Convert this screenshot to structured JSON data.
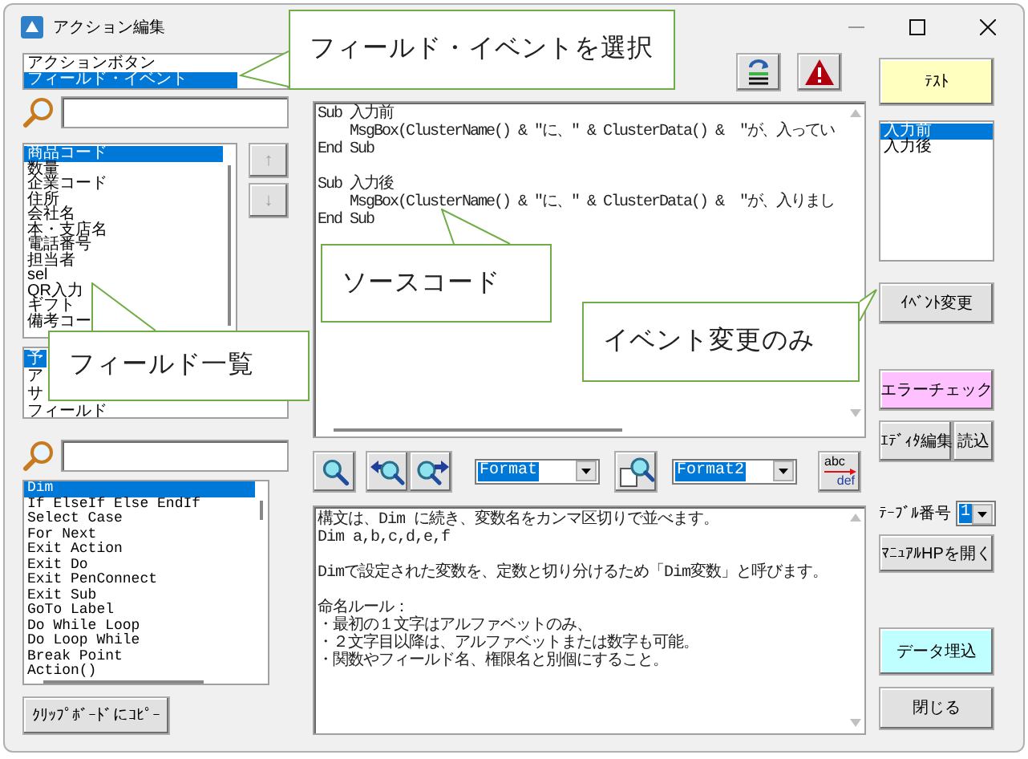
{
  "window": {
    "title": "アクション編集"
  },
  "type_list": {
    "items": [
      {
        "label": "アクションボタン",
        "selected": false
      },
      {
        "label": "フィールド・イベント",
        "selected": true
      }
    ]
  },
  "field_list": {
    "items": [
      {
        "label": "商品コード",
        "selected": true
      },
      {
        "label": "数量",
        "selected": false
      },
      {
        "label": "企業コード",
        "selected": false
      },
      {
        "label": "住所",
        "selected": false
      },
      {
        "label": "会社名",
        "selected": false
      },
      {
        "label": "本・支店名",
        "selected": false
      },
      {
        "label": "電話番号",
        "selected": false
      },
      {
        "label": "担当者",
        "selected": false
      },
      {
        "label": "sel",
        "selected": false
      },
      {
        "label": "QR入力",
        "selected": false
      },
      {
        "label": "ギフト",
        "selected": false
      },
      {
        "label": "備考コー",
        "selected": false
      }
    ]
  },
  "move_buttons": [
    {
      "label": "↑",
      "disabled": true
    },
    {
      "label": "↓",
      "disabled": true
    }
  ],
  "category_list": {
    "items": [
      {
        "label": "予",
        "selected": true
      },
      {
        "label": "ア",
        "selected": false
      },
      {
        "label": "サ",
        "selected": false
      },
      {
        "label": "フィールド",
        "selected": false
      }
    ]
  },
  "keyword_list": {
    "items": [
      {
        "label": "Dim",
        "selected": true
      },
      {
        "label": "If ElseIf Else EndIf",
        "selected": false
      },
      {
        "label": "Select Case",
        "selected": false
      },
      {
        "label": "For Next",
        "selected": false
      },
      {
        "label": "Exit Action",
        "selected": false
      },
      {
        "label": "Exit Do",
        "selected": false
      },
      {
        "label": "Exit PenConnect",
        "selected": false
      },
      {
        "label": "Exit Sub",
        "selected": false
      },
      {
        "label": "GoTo Label",
        "selected": false
      },
      {
        "label": "Do While Loop",
        "selected": false
      },
      {
        "label": "Do Loop While",
        "selected": false
      },
      {
        "label": "Break Point",
        "selected": false
      },
      {
        "label": "Action()",
        "selected": false
      }
    ]
  },
  "copy_button": "ｸﾘｯﾌﾟﾎﾞｰﾄﾞにｺﾋﾟｰ",
  "editor": {
    "blocks": [
      [
        "Sub 入力前",
        "    MsgBox(ClusterName() & \"に、\" & ClusterData() &  \"が、入ってい",
        "End Sub"
      ],
      [
        "Sub 入力後",
        "    MsgBox(ClusterName() & \"に、\" & ClusterData() &  \"が、入りまし",
        "End Sub"
      ]
    ]
  },
  "search_toolbar": {
    "format_combo": "Format",
    "format2_combo": "Format2",
    "replace_button": {
      "top": "abc",
      "bottom": "def"
    }
  },
  "help_paragraphs": [
    [
      "構文は、Dim に続き、変数名をカンマ区切りで並べます。",
      "Dim a,b,c,d,e,f"
    ],
    [
      "Dimで設定された変数を、定数と切り分けるため「Dim変数」と呼びます。"
    ],
    [
      "命名ルール：",
      "・最初の１文字はアルファベットのみ、",
      "・２文字目以降は、アルファベットまたは数字も可能。",
      "・関数やフィールド名、権限名と別個にすること。"
    ]
  ],
  "test_button": "ﾃｽﾄ",
  "event_list": {
    "items": [
      {
        "label": "入力前",
        "selected": true
      },
      {
        "label": "入力後",
        "selected": false
      }
    ]
  },
  "event_change_button": "ｲﾍﾞﾝﾄ変更",
  "error_check_button": "エラーチェック",
  "editor_edit_button": "ｴﾃﾞｨﾀ編集",
  "load_button": "読込",
  "table_number": {
    "label": "ﾃｰﾌﾞﾙ番号",
    "value": "1"
  },
  "manual_button": "ﾏﾆｭｱﾙHPを開く",
  "embed_button": "データ埋込",
  "close_button": "閉じる",
  "callouts": [
    "フィールド・イベントを選択",
    "ソースコード",
    "イベント変更のみ",
    "フィールド一覧"
  ]
}
